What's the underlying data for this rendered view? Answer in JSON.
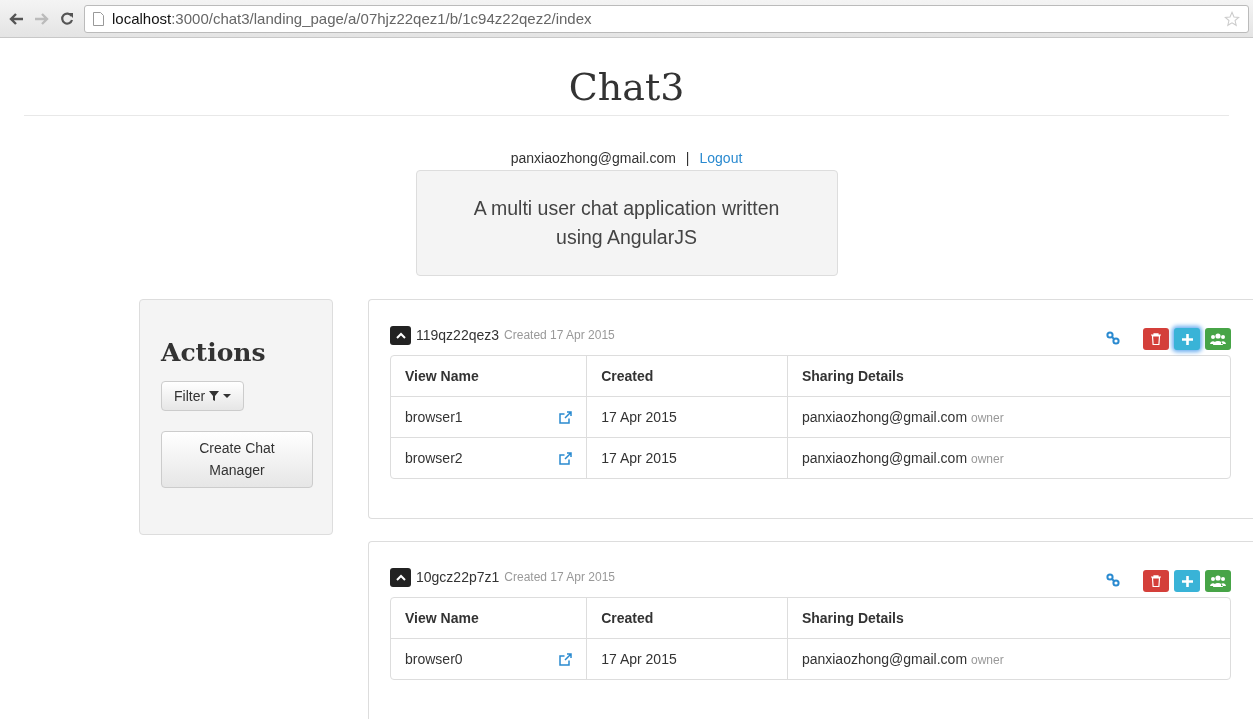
{
  "browser": {
    "url": "**localhost**:3000/chat3/landing_page/a/07hjz22qez1/b/1c94z22qez2/index"
  },
  "header": {
    "title": "Chat3"
  },
  "user": {
    "email": "panxiaozhong@gmail.com",
    "separator": "|",
    "logout": "Logout"
  },
  "description": "A multi user chat application written using AngularJS",
  "actions": {
    "title": "Actions",
    "filter": "Filter",
    "create": "Create Chat Manager"
  },
  "managers": [
    {
      "name": "119qz22qez3",
      "created": "Created 17 Apr 2015",
      "add_focused": true,
      "columns": [
        "View Name",
        "Created",
        "Sharing Details"
      ],
      "rows": [
        {
          "view": "browser1",
          "created": "17 Apr 2015",
          "email": "panxiaozhong@gmail.com",
          "role": "owner"
        },
        {
          "view": "browser2",
          "created": "17 Apr 2015",
          "email": "panxiaozhong@gmail.com",
          "role": "owner"
        }
      ]
    },
    {
      "name": "10gcz22p7z1",
      "created": "Created 17 Apr 2015",
      "add_focused": false,
      "columns": [
        "View Name",
        "Created",
        "Sharing Details"
      ],
      "rows": [
        {
          "view": "browser0",
          "created": "17 Apr 2015",
          "email": "panxiaozhong@gmail.com",
          "role": "owner"
        }
      ]
    }
  ]
}
